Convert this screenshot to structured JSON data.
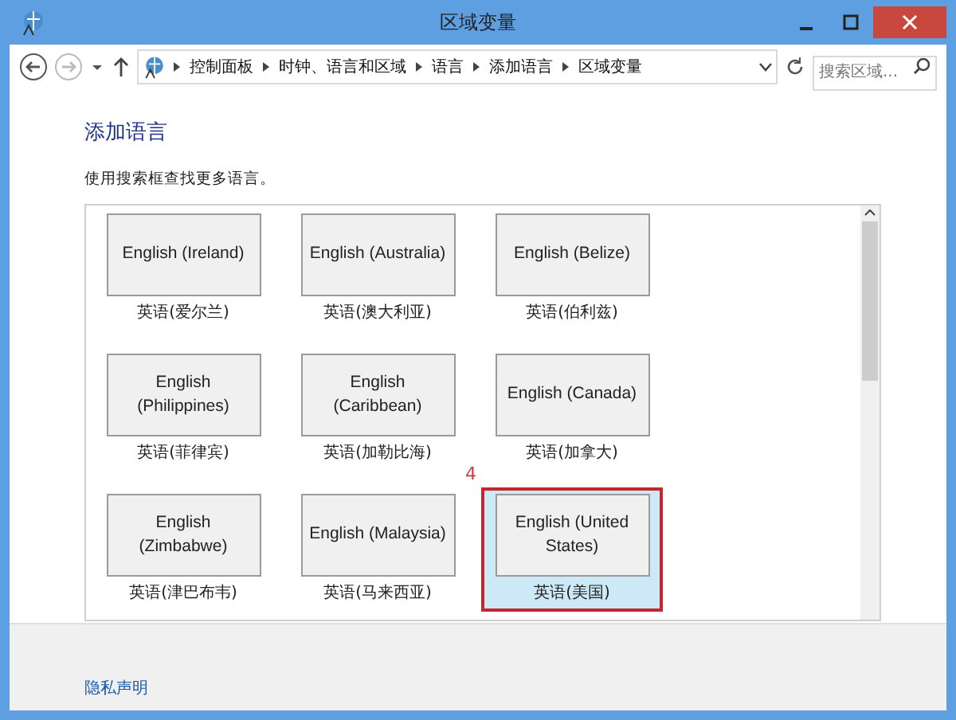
{
  "window": {
    "title": "区域变量"
  },
  "address_bar": {
    "breadcrumbs": [
      "控制面板",
      "时钟、语言和区域",
      "语言",
      "添加语言",
      "区域变量"
    ],
    "search": {
      "placeholder": "搜索区域..."
    }
  },
  "heading": "添加语言",
  "hint": "使用搜索框查找更多语言。",
  "languages": [
    {
      "name": "English (Ireland)",
      "native": "英语(爱尔兰)",
      "selected": false
    },
    {
      "name": "English (Australia)",
      "native": "英语(澳大利亚)",
      "selected": false
    },
    {
      "name": "English (Belize)",
      "native": "英语(伯利兹)",
      "selected": false
    },
    {
      "name": "English (Philippines)",
      "native": "英语(菲律宾)",
      "selected": false
    },
    {
      "name": "English (Caribbean)",
      "native": "英语(加勒比海)",
      "selected": false
    },
    {
      "name": "English (Canada)",
      "native": "英语(加拿大)",
      "selected": false
    },
    {
      "name": "English (Zimbabwe)",
      "native": "英语(津巴布韦)",
      "selected": false
    },
    {
      "name": "English (Malaysia)",
      "native": "英语(马来西亚)",
      "selected": false
    },
    {
      "name": "English (United States)",
      "native": "英语(美国)",
      "selected": true
    }
  ],
  "annotation": {
    "label": "4"
  },
  "footer": {
    "link": "隐私声明"
  }
}
